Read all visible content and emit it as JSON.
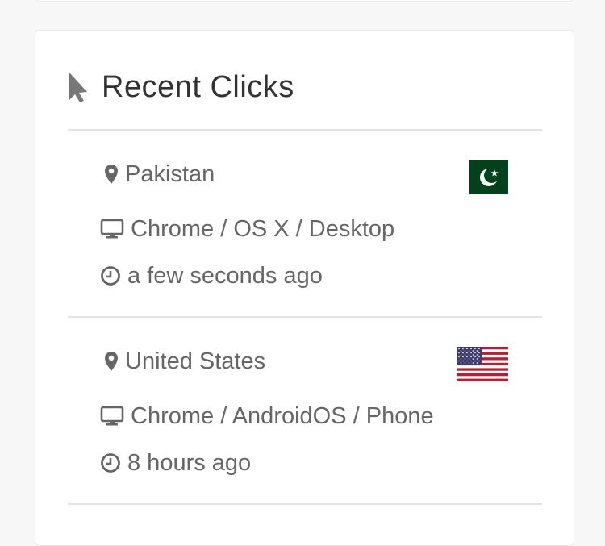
{
  "card": {
    "title": "Recent Clicks",
    "title_icon": "cursor-pointer-icon"
  },
  "clicks": [
    {
      "country": "Pakistan",
      "flag": "pakistan-flag",
      "device": "Chrome / OS X / Desktop",
      "time": "a few seconds ago"
    },
    {
      "country": "United States",
      "flag": "us-flag",
      "device": "Chrome / AndroidOS / Phone",
      "time": "8 hours ago"
    }
  ],
  "colors": {
    "text_primary": "#333333",
    "text_secondary": "#666666",
    "divider": "#e3e3e3",
    "card_border": "#e6e6e6",
    "pakistan_green": "#01411c",
    "us_red": "#b22234",
    "us_blue": "#3c3b6e"
  }
}
